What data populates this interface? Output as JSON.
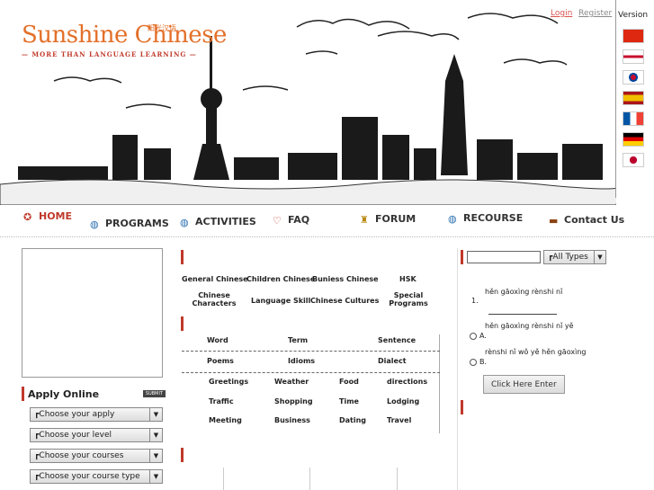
{
  "header": {
    "brand": "Sunshine Chinese",
    "brand_cn": "阳光汉语",
    "tagline": "— MORE THAN LANGUAGE LEARNING —",
    "login": "Login",
    "register": "Register",
    "version_label": "Version",
    "flags": [
      "china-flag",
      "england-flag",
      "korea-flag",
      "spain-flag",
      "france-flag",
      "germany-flag",
      "japan-flag"
    ]
  },
  "nav": [
    {
      "label": "HOME",
      "color": "#c0392b"
    },
    {
      "label": "PROGRAMS"
    },
    {
      "label": "ACTIVITIES"
    },
    {
      "label": "FAQ"
    },
    {
      "label": "FORUM"
    },
    {
      "label": "RECOURSE"
    },
    {
      "label": "Contact Us"
    }
  ],
  "apply": {
    "title": "Apply Online",
    "submit": "SUBMIT",
    "selects": [
      "Choose your apply",
      "Choose your level",
      "Choose your courses",
      "Choose your course type",
      ""
    ]
  },
  "programs": [
    "General Chinese",
    "Children Chinese",
    "Buniess Chinese",
    "HSK",
    "Chinese Characters",
    "Language Skill",
    "Chinese Cultures",
    "Special Programs"
  ],
  "topics": [
    "Word",
    "Term",
    "Sentence",
    "Poems",
    "Idioms",
    "Dialect",
    "Greetings",
    "Weather",
    "Food",
    "directions",
    "Traffic",
    "Shopping",
    "Time",
    "Lodging",
    "Meeting",
    "Business",
    "Dating",
    "Travel"
  ],
  "quiz": {
    "type_select": "All Types",
    "question": "hěn gāoxìng rènshi nǐ",
    "number": "1.",
    "option_a_text": "hěn gāoxìng rènshi nǐ yě",
    "option_a": "A.",
    "option_b_text": "rènshi nǐ wǒ yě hěn gāoxìng",
    "option_b": "B.",
    "enter_button": "Click Here Enter"
  }
}
